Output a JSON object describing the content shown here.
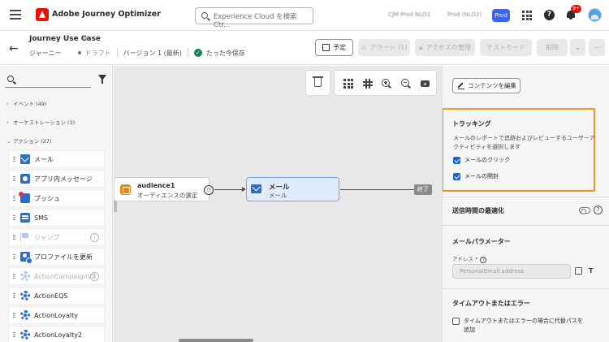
{
  "topbar": {
    "app_title": "Adobe Journey Optimizer",
    "search_placeholder": "Experience Cloud を検索 Ctr...",
    "org_name": "CJM Prod NLD2",
    "sandbox_name": "Prod (NLD2)",
    "sandbox_badge": "Prod",
    "notification_count": "9+",
    "help_glyph": "?"
  },
  "header": {
    "journey_name": "Journey Use Case",
    "type": "ジャーニー",
    "status": "ドラフト",
    "version": "バージョン 1 (最新)",
    "save_status": "たった今保存",
    "buttons": {
      "schedule": "予定",
      "alerts": "アラート (1)",
      "access": "アクセスの管理",
      "test_mode": "テストモード",
      "delete": "削除"
    }
  },
  "sidebar": {
    "categories": {
      "events": "イベント (49)",
      "orchestration": "オーケストレーション (3)",
      "actions": "アクション (27)"
    },
    "actions": [
      {
        "label": "メール"
      },
      {
        "label": "アプリ内メッセージ"
      },
      {
        "label": "プッシュ"
      },
      {
        "label": "SMS"
      },
      {
        "label": "ジャンプ"
      },
      {
        "label": "プロファイルを更新"
      },
      {
        "label": "ActionCampaignV8"
      },
      {
        "label": "ActionEQS"
      },
      {
        "label": "ActionLoyalty"
      },
      {
        "label": "ActionLoyalty2"
      }
    ]
  },
  "canvas": {
    "audience_node": {
      "title": "audience1",
      "subtitle": "オーディエンスの選定"
    },
    "mail_node": {
      "title": "メール",
      "subtitle": "メール"
    },
    "end_label": "終了"
  },
  "panel": {
    "edit_content_button": "コンテンツを編集",
    "tracking": {
      "title": "トラッキング",
      "description": "メールのレポートで追跡およびレビューするユーザーアクティビティを選択します",
      "click_label": "メールのクリック",
      "open_label": "メールの開封"
    },
    "send_time": {
      "title": "送信時間の最適化"
    },
    "email_params": {
      "title": "メールパラメーター",
      "address_label": "アドレス",
      "address_placeholder": "PersonalEmail.address"
    },
    "timeout": {
      "title": "タイムアウトまたはエラー",
      "checkbox_label": "タイムアウトまたはエラーの場合に代替パスを追加"
    }
  }
}
